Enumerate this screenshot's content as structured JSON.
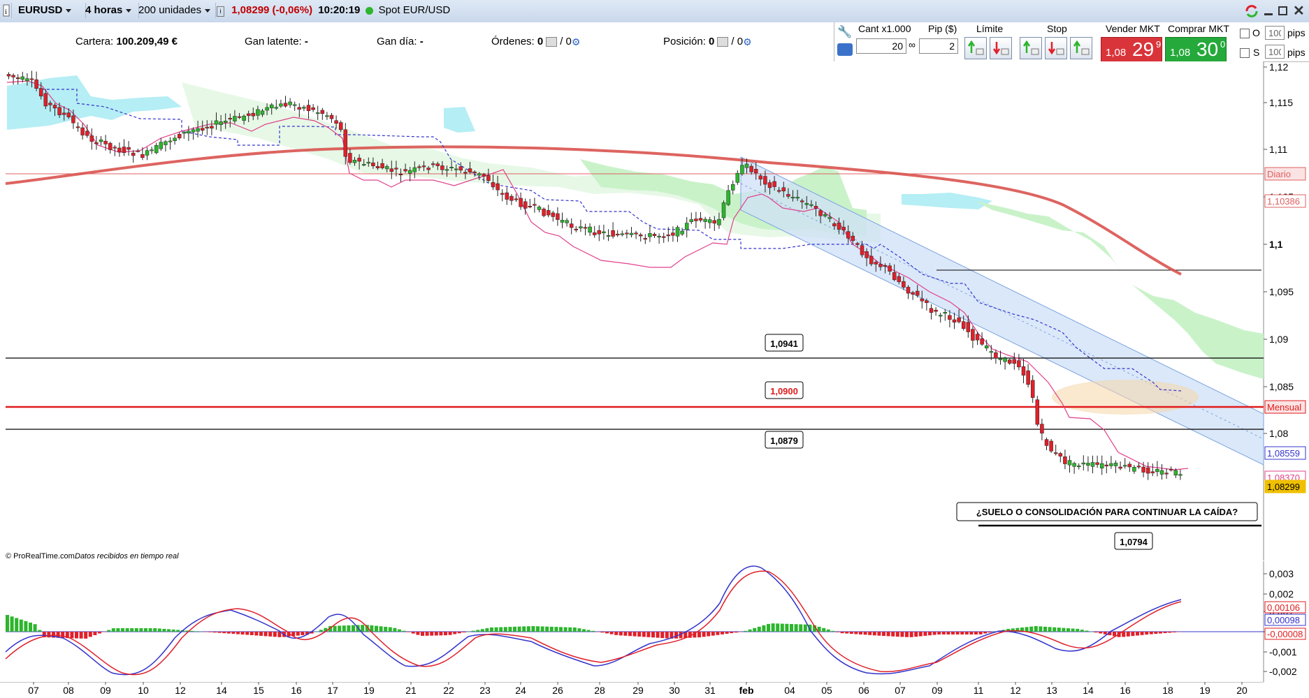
{
  "toolbar": {
    "symbol": "EURUSD",
    "timeframe": "4 horas",
    "units": "200 unidades",
    "quote": "1,08299 (-0,06%)",
    "time": "10:20:19",
    "instrument": "Spot EUR/USD"
  },
  "info": {
    "cartera_label": "Cartera:",
    "cartera_value": "100.209,49 €",
    "gan_latente_label": "Gan latente:",
    "gan_latente_value": "-",
    "gan_dia_label": "Gan día:",
    "gan_dia_value": "-",
    "ordenes_label": "Órdenes:",
    "ordenes_value1": "0",
    "ordenes_value2": "/ 0",
    "posicion_label": "Posición:",
    "posicion_value1": "0",
    "posicion_value2": "/ 0"
  },
  "order_panel": {
    "cant_label": "Cant x1.000",
    "cant_value": "20",
    "pip_label": "Pip ($)",
    "pip_value": "2",
    "limite_label": "Límite",
    "stop_label": "Stop",
    "sell_label": "Vender MKT",
    "sell_price_small": "1,08",
    "sell_price_big": "29",
    "sell_price_sup": "9",
    "buy_label": "Comprar MKT",
    "buy_price_small": "1,08",
    "buy_price_big": "30",
    "buy_price_sup": "0",
    "o_label": "O",
    "s_label": "S",
    "pips_value1": "100",
    "pips_value2": "100",
    "pips_label": "pips"
  },
  "chart_data": [
    {
      "type": "line",
      "right_axis_ticks": [
        "1,12",
        "1,115",
        "1,11",
        "1,105",
        "1,1",
        "1,095",
        "1,09",
        "1,085",
        "1,08"
      ],
      "x_tick_labels": [
        "07",
        "08",
        "09",
        "10",
        "12",
        "14",
        "15",
        "16",
        "17",
        "19",
        "21",
        "22",
        "23",
        "24",
        "26",
        "28",
        "29",
        "30",
        "31",
        "feb",
        "04",
        "05",
        "06",
        "07",
        "09",
        "11",
        "12",
        "13",
        "14",
        "16",
        "18",
        "19",
        "20"
      ],
      "horizontal_levels": [
        {
          "value": 1.0941,
          "label": "1,0941",
          "color": "#000000"
        },
        {
          "value": 1.09,
          "label": "1,0900",
          "color": "#e01b1b"
        },
        {
          "value": 1.0879,
          "label": "1,0879",
          "color": "#000000"
        },
        {
          "value": 1.0794,
          "label": "1,0794",
          "color": "#000000"
        },
        {
          "value": 1.1081,
          "label": "Diario",
          "color": "#e06060"
        }
      ],
      "axis_badges": [
        {
          "label": "Diario",
          "color": "#e06060"
        },
        {
          "label": "1,10386",
          "color": "#e06060"
        },
        {
          "label": "Mensual",
          "color": "#e01b1b"
        },
        {
          "label": "1,08559",
          "color": "#3333cc"
        },
        {
          "label": "1,08370",
          "color": "#e0408a"
        },
        {
          "label": "1,08299",
          "color": "#f0c000"
        }
      ],
      "annotation": "¿SUELO O CONSOLIDACIÓN PARA CONTINUAR LA CAÍDA?",
      "footer_left": "© ProRealTime.com",
      "footer_right": "Datos recibidos en tiempo real",
      "ylim": [
        1.077,
        1.121
      ]
    },
    {
      "type": "bar",
      "right_axis_ticks": [
        "0,003",
        "0,002",
        "0,001",
        "0",
        "-0,001",
        "-0,002"
      ],
      "axis_badges": [
        {
          "label": "0,00106",
          "color": "#e01b1b"
        },
        {
          "label": "0,00098",
          "color": "#3333cc"
        },
        {
          "label": "-0,00008",
          "color": "#e01b1b"
        }
      ],
      "ylim": [
        -0.0025,
        0.0032
      ]
    }
  ],
  "colors": {
    "bull": "#2db52d",
    "bear": "#e0202a",
    "ma_thick": "#d9534f",
    "tenkan": "#e0408a",
    "kijun": "#3333cc",
    "channel": "#cfe0f7",
    "kumo_green": "#c9f2c9",
    "kumo_cyan": "#b5eef5"
  }
}
